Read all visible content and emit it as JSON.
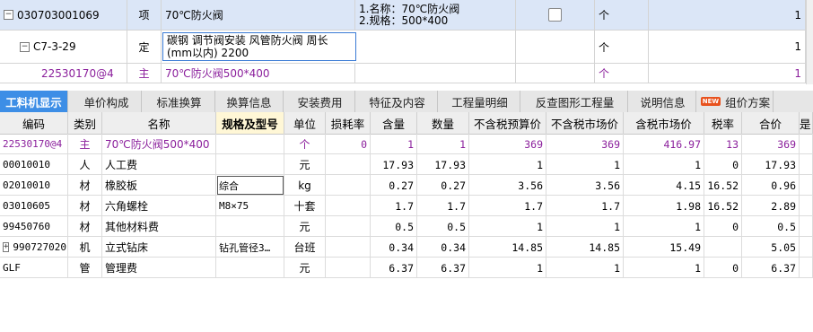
{
  "top_rows": [
    {
      "code": "030703001069",
      "type": "项",
      "name": "70℃防火阀",
      "feature_line1": "1.名称：70℃防火阀",
      "feature_line2": "2.规格：500*400",
      "unit": "个",
      "qty": "1"
    },
    {
      "code": "C7-3-29",
      "type": "定",
      "name": "碳钢 调节阀安装 风管防火阀 周长(mm以内) 2200",
      "unit": "个",
      "qty": "1"
    },
    {
      "code": "22530170@4",
      "type": "主",
      "name": "70℃防火阀500*400",
      "unit": "个",
      "qty": "1"
    }
  ],
  "tabs": [
    "工料机显示",
    "单价构成",
    "标准换算",
    "换算信息",
    "安装费用",
    "特征及内容",
    "工程量明细",
    "反查图形工程量",
    "说明信息",
    "组价方案"
  ],
  "new_badge": "NEW",
  "headers": [
    "编码",
    "类别",
    "名称",
    "规格及型号",
    "单位",
    "损耗率",
    "含量",
    "数量",
    "不含税预算价",
    "不含税市场价",
    "含税市场价",
    "税率",
    "合价",
    "是"
  ],
  "rows": [
    {
      "code": "22530170@4",
      "cat": "主",
      "name": "70℃防火阀500*400",
      "spec": "",
      "unit": "个",
      "loss": "0",
      "content": "1",
      "qty": "1",
      "pre_budget": "369",
      "pre_market": "369",
      "tax_market": "416.97",
      "rate": "13",
      "total": "369"
    },
    {
      "code": "00010010",
      "cat": "人",
      "name": "人工费",
      "spec": "",
      "unit": "元",
      "loss": "",
      "content": "17.93",
      "qty": "17.93",
      "pre_budget": "1",
      "pre_market": "1",
      "tax_market": "1",
      "rate": "0",
      "total": "17.93"
    },
    {
      "code": "02010010",
      "cat": "材",
      "name": "橡胶板",
      "spec": "综合",
      "unit": "kg",
      "loss": "",
      "content": "0.27",
      "qty": "0.27",
      "pre_budget": "3.56",
      "pre_market": "3.56",
      "tax_market": "4.15",
      "rate": "16.52",
      "total": "0.96"
    },
    {
      "code": "03010605",
      "cat": "材",
      "name": "六角螺栓",
      "spec": "M8×75",
      "unit": "十套",
      "loss": "",
      "content": "1.7",
      "qty": "1.7",
      "pre_budget": "1.7",
      "pre_market": "1.7",
      "tax_market": "1.98",
      "rate": "16.52",
      "total": "2.89"
    },
    {
      "code": "99450760",
      "cat": "材",
      "name": "其他材料费",
      "spec": "",
      "unit": "元",
      "loss": "",
      "content": "0.5",
      "qty": "0.5",
      "pre_budget": "1",
      "pre_market": "1",
      "tax_market": "1",
      "rate": "0",
      "total": "0.5"
    },
    {
      "code": "990727020",
      "cat": "机",
      "name": "立式钻床",
      "spec": "钻孔管径3…",
      "unit": "台班",
      "loss": "",
      "content": "0.34",
      "qty": "0.34",
      "pre_budget": "14.85",
      "pre_market": "14.85",
      "tax_market": "15.49",
      "rate": "",
      "total": "5.05"
    },
    {
      "code": "GLF",
      "cat": "管",
      "name": "管理费",
      "spec": "",
      "unit": "元",
      "loss": "",
      "content": "6.37",
      "qty": "6.37",
      "pre_budget": "1",
      "pre_market": "1",
      "tax_market": "1",
      "rate": "0",
      "total": "6.37"
    }
  ],
  "expander_plus": "+",
  "expander_minus": "−",
  "colors": {
    "accent": "#3d8ee6",
    "selected_row": "#dbe6f7",
    "purple": "#8b1f9c"
  }
}
